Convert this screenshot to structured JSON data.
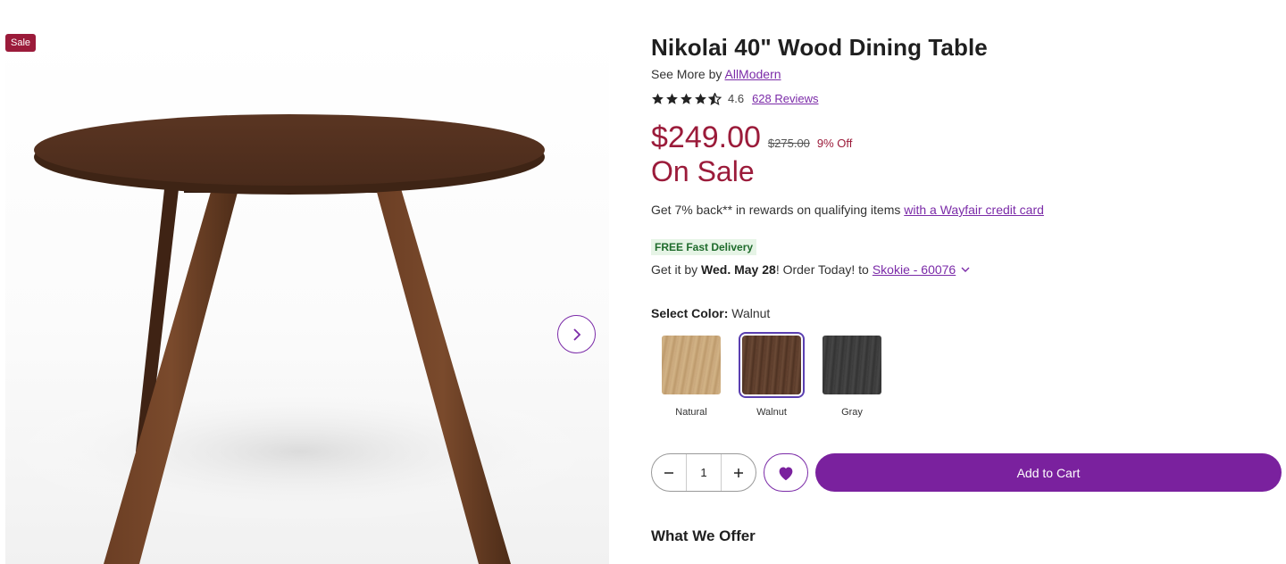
{
  "gallery": {
    "badge": "Sale",
    "image_alt": "Nikolai 40\" Wood Dining Table in Walnut",
    "next_icon": "chevron-right-icon"
  },
  "product": {
    "title": "Nikolai 40\" Wood Dining Table",
    "see_more_prefix": "See More by",
    "brand": "AllModern",
    "rating": "4.6",
    "rating_value": 4.6,
    "reviews_link": "628 Reviews",
    "price": "$249.00",
    "old_price": "$275.00",
    "pct_off": "9% Off",
    "sale_label": "On Sale"
  },
  "rewards": {
    "text": "Get 7% back** in rewards on qualifying items",
    "link": "with a Wayfair credit card"
  },
  "delivery": {
    "badge": "FREE Fast Delivery",
    "prefix": "Get it by",
    "date": "Wed. May 28",
    "middle": "! Order Today! to",
    "location": "Skokie - 60076"
  },
  "color": {
    "label": "Select Color:",
    "selected": "Walnut",
    "options": [
      {
        "label": "Natural"
      },
      {
        "label": "Walnut"
      },
      {
        "label": "Gray"
      }
    ]
  },
  "cart": {
    "quantity": "1",
    "add_label": "Add to Cart"
  },
  "offer_heading": "What We Offer",
  "colors": {
    "brand_purple": "#7a219e",
    "sale_red": "#9b1b3a",
    "delivery_green": "#1f6b2c"
  }
}
